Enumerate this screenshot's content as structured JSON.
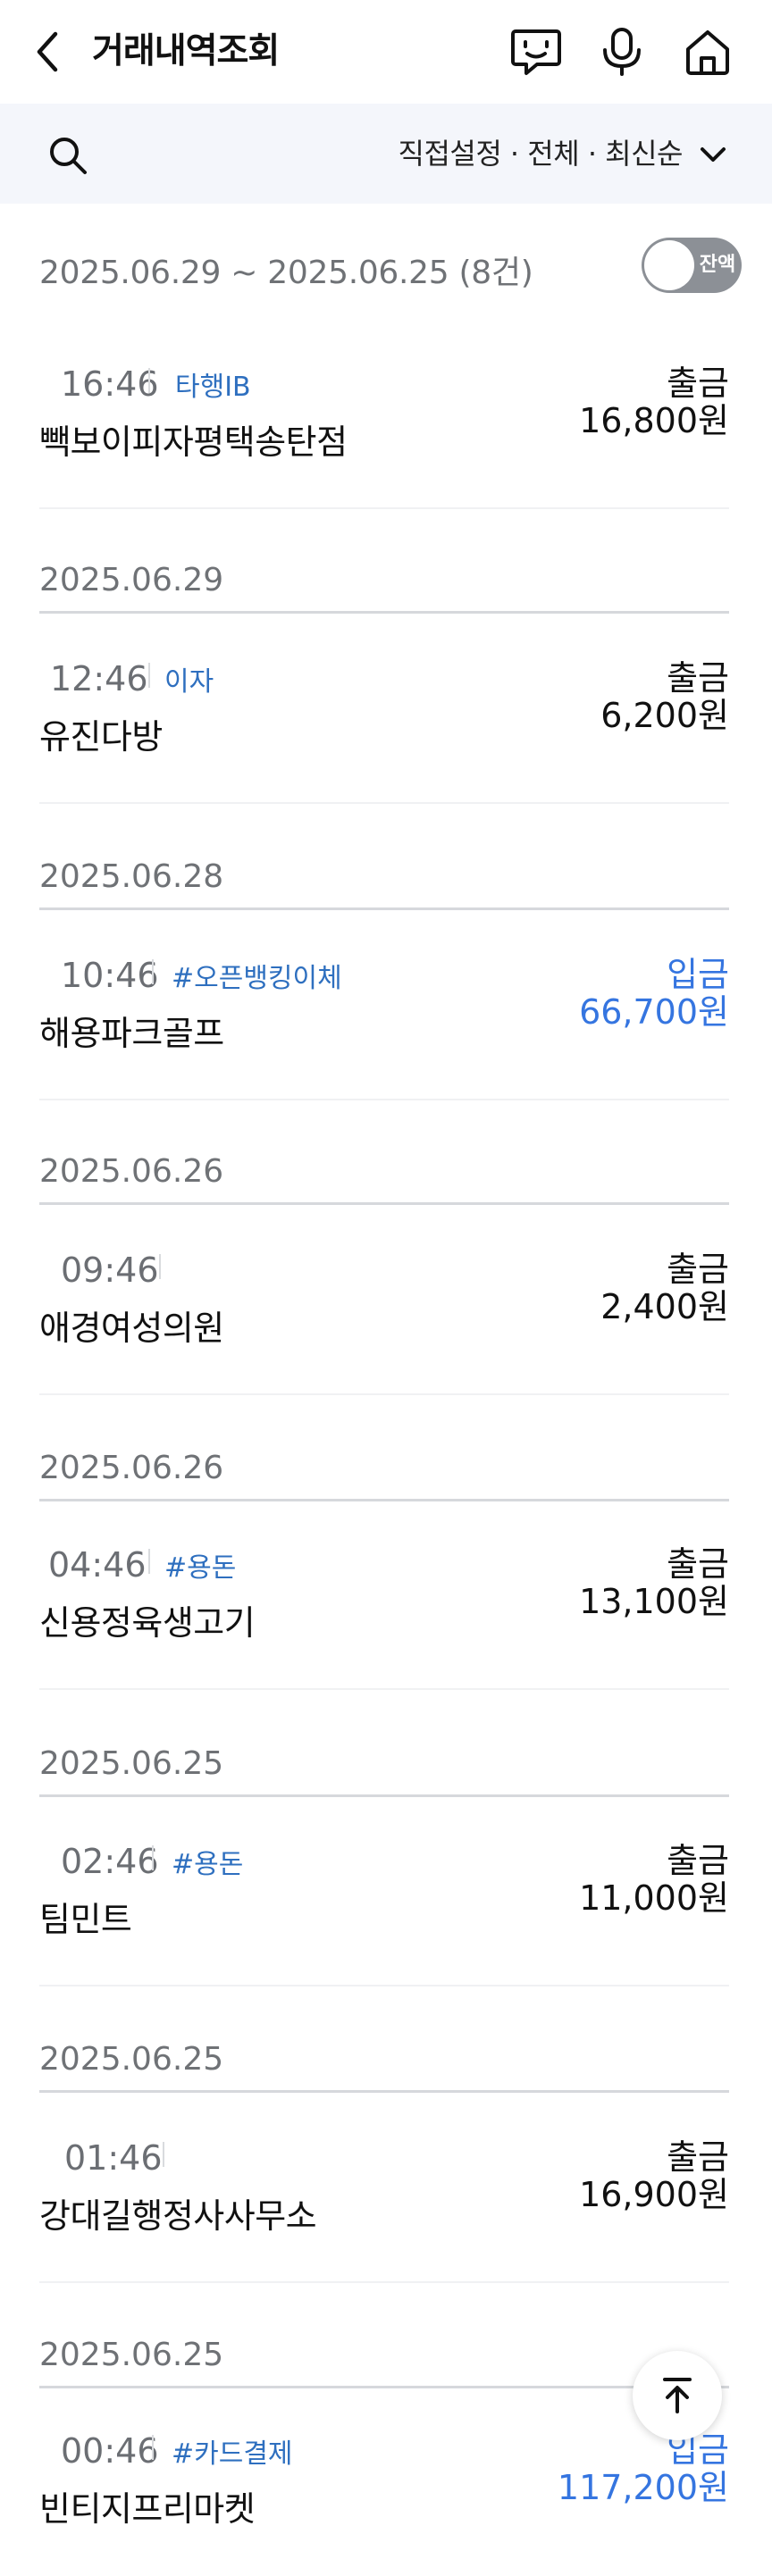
{
  "header": {
    "title": "거래내역조회",
    "icons": [
      "back-icon",
      "chat-bot-icon",
      "microphone-icon",
      "home-icon"
    ]
  },
  "filter": {
    "label": "직접설정 · 전체 · 최신순"
  },
  "summary": {
    "range": "2025.06.29 ~ 2025.06.25 (8건)",
    "toggle_label": "잔액"
  },
  "dates": [
    "2025.06.29",
    "2025.06.28",
    "2025.06.26",
    "2025.06.26",
    "2025.06.25",
    "2025.06.25",
    "2025.06.25"
  ],
  "transactions": [
    {
      "time": "16:46",
      "category": "타행IB",
      "merchant": "빽보이피자평택송탄점",
      "kind": "출금",
      "amount": "16,800원",
      "direction": "out"
    },
    {
      "time": "12:46",
      "category": "이자",
      "merchant": "유진다방",
      "kind": "출금",
      "amount": "6,200원",
      "direction": "out"
    },
    {
      "time": "10:46",
      "category": "#오픈뱅킹이체",
      "merchant": "해용파크골프",
      "kind": "입금",
      "amount": "66,700원",
      "direction": "in"
    },
    {
      "time": "09:46",
      "category": "",
      "merchant": "애경여성의원",
      "kind": "출금",
      "amount": "2,400원",
      "direction": "out"
    },
    {
      "time": "04:46",
      "category": "#용돈",
      "merchant": "신용정육생고기",
      "kind": "출금",
      "amount": "13,100원",
      "direction": "out"
    },
    {
      "time": "02:46",
      "category": "#용돈",
      "merchant": "팀민트",
      "kind": "출금",
      "amount": "11,000원",
      "direction": "out"
    },
    {
      "time": "01:46",
      "category": "",
      "merchant": "강대길행정사사무소",
      "kind": "출금",
      "amount": "16,900원",
      "direction": "out"
    },
    {
      "time": "00:46",
      "category": "#카드결제",
      "merchant": "빈티지프리마켓",
      "kind": "입금",
      "amount": "117,200원",
      "direction": "in"
    }
  ],
  "colors": {
    "deposit": "#3575e0",
    "withdrawal": "#111111",
    "category": "#2e6fbf",
    "filter_bg": "#f4f6fb"
  }
}
